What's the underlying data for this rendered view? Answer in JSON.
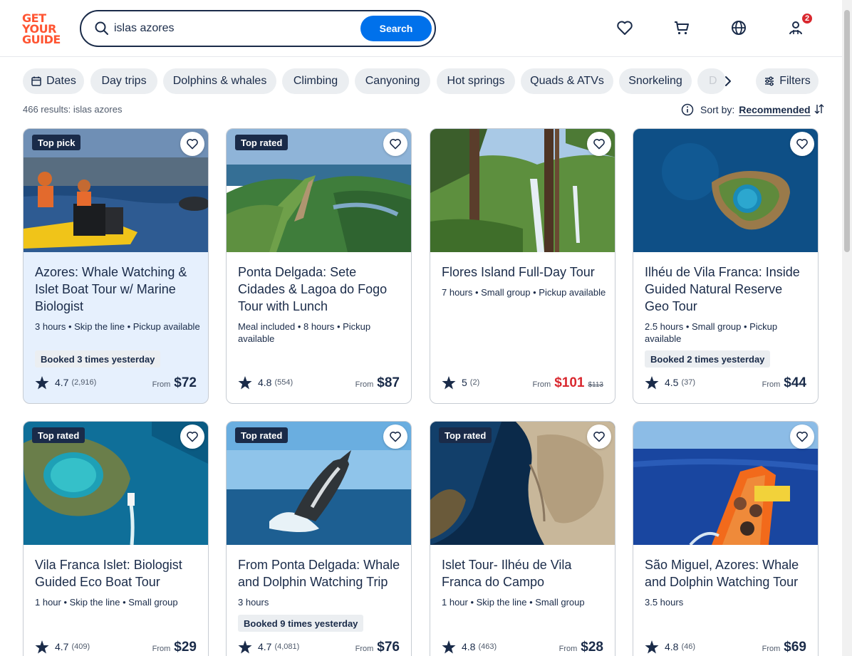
{
  "brand": {
    "logo_lines": [
      "GET",
      "YOUR",
      "GUIDE"
    ],
    "logo_color": "#ff5533"
  },
  "search": {
    "query": "islas azores",
    "button_label": "Search",
    "icon": "search-icon"
  },
  "header_icons": {
    "wishlist": "heart-icon",
    "cart": "cart-icon",
    "language": "globe-icon",
    "account": "user-icon",
    "badge_count": "2"
  },
  "chips": [
    {
      "label": "Dates",
      "icon": "calendar-icon"
    },
    {
      "label": "Day trips"
    },
    {
      "label": "Dolphins & whales"
    },
    {
      "label": "Climbing"
    },
    {
      "label": "Canyoning"
    },
    {
      "label": "Hot springs"
    },
    {
      "label": "Quads & ATVs"
    },
    {
      "label": "Snorkeling"
    },
    {
      "label": "D"
    }
  ],
  "filters_label": "Filters",
  "results_text": "466 results: islas azores",
  "sort": {
    "label": "Sort by:",
    "value": "Recommended"
  },
  "cards": [
    {
      "tag": "Top pick",
      "title": "Azores: Whale Watching & Islet Boat Tour w/ Marine Biologist",
      "meta": "3 hours • Skip the line • Pickup available",
      "booked": "Booked 3 times yesterday",
      "rating": "4.7",
      "reviews": "(2,916)",
      "from": "From",
      "price": "$72",
      "highlighted": true
    },
    {
      "tag": "Top rated",
      "title": "Ponta Delgada: Sete Cidades & Lagoa do Fogo Tour with Lunch",
      "meta": "Meal included • 8 hours • Pickup available",
      "rating": "4.8",
      "reviews": "(554)",
      "from": "From",
      "price": "$87"
    },
    {
      "title": "Flores Island Full-Day Tour",
      "meta": "7 hours • Small group • Pickup available",
      "rating": "5",
      "reviews": "(2)",
      "from": "From",
      "price": "$101",
      "old_price": "$113",
      "sale_color": "#d9282f"
    },
    {
      "title": "Ilhéu de Vila Franca: Inside Guided Natural Reserve Geo Tour",
      "meta": "2.5 hours • Small group • Pickup available",
      "booked": "Booked 2 times yesterday",
      "rating": "4.5",
      "reviews": "(37)",
      "from": "From",
      "price": "$44"
    },
    {
      "tag": "Top rated",
      "title": "Vila Franca Islet: Biologist Guided Eco Boat Tour",
      "meta": "1 hour • Skip the line • Small group",
      "rating": "4.7",
      "reviews": "(409)",
      "from": "From",
      "price": "$29"
    },
    {
      "tag": "Top rated",
      "title": "From Ponta Delgada: Whale and Dolphin Watching Trip",
      "meta": "3 hours",
      "booked": "Booked 9 times yesterday",
      "rating": "4.7",
      "reviews": "(4,081)",
      "from": "From",
      "price": "$76"
    },
    {
      "tag": "Top rated",
      "title": "Islet Tour- Ilhéu de Vila Franca do Campo",
      "meta": "1 hour • Skip the line • Small group",
      "rating": "4.8",
      "reviews": "(463)",
      "from": "From",
      "price": "$28"
    },
    {
      "title": "São Miguel, Azores: Whale and Dolphin Watching Tour",
      "meta": "3.5 hours",
      "rating": "4.8",
      "reviews": "(46)",
      "from": "From",
      "price": "$69"
    }
  ]
}
